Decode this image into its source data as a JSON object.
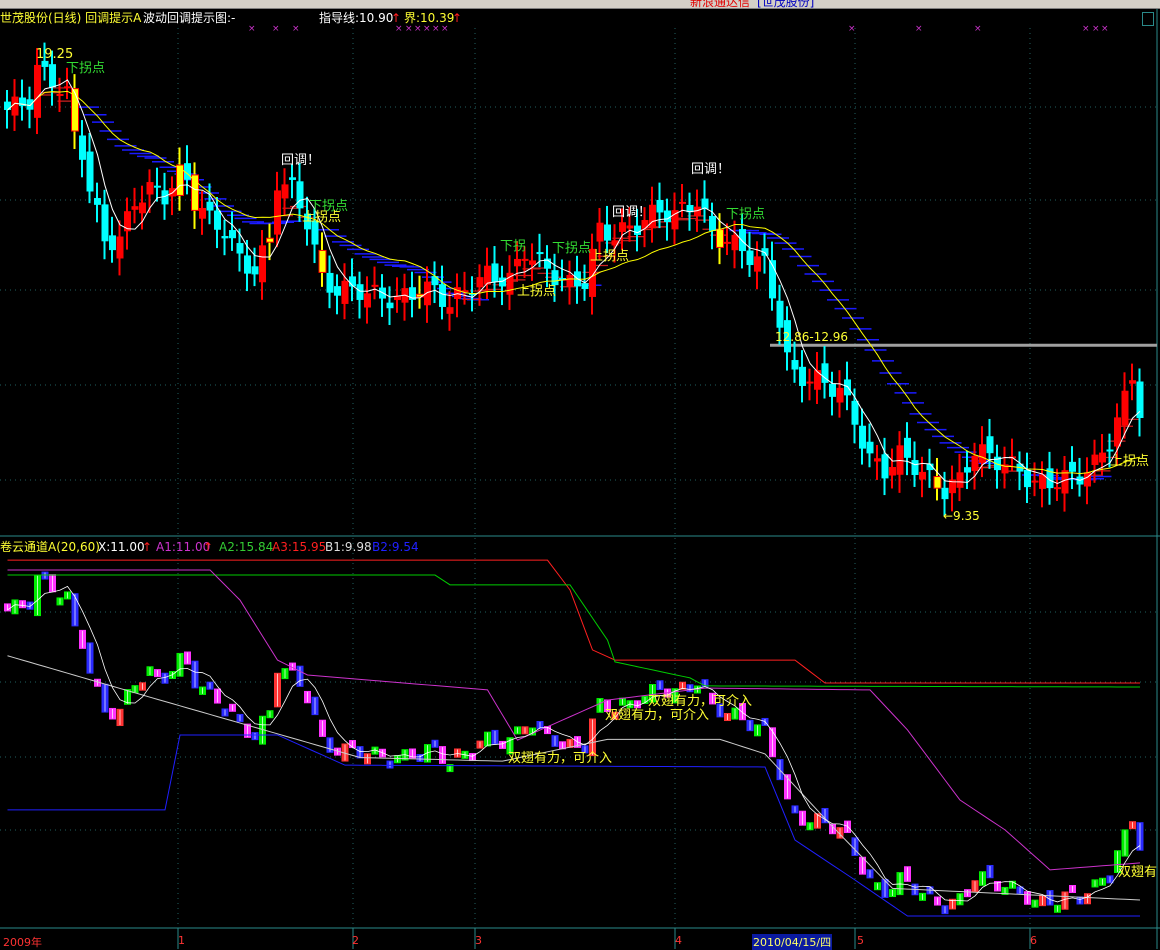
{
  "window": {
    "title_red": "新浪通达信",
    "title_blue": "[世茂股份]"
  },
  "top_panel": {
    "header": {
      "name": "世茂股份(日线) 回调提示A",
      "subtitle": "波动回调提示图:-",
      "guide_label": "指导线:10.90",
      "bound_label": "界:10.39",
      "up_arrow": "↑"
    },
    "marker_glyph": "×",
    "annotations": {
      "high": "19.25",
      "low": "←9.35",
      "range": "12.86-12.96",
      "down_turn": "下拐点",
      "down_turn_partial": "下拐",
      "up_turn": "上拐点",
      "pullback": "回调！"
    }
  },
  "bottom_panel": {
    "header": {
      "name": "卷云通道A(20,60)",
      "x": "X:11.00",
      "a1": "A1:11.00",
      "a2": "A2:15.84",
      "a3": "A3:15.95",
      "b1": "B1:9.98",
      "b2": "B2:9.54",
      "up_arrow": "↑"
    },
    "signal_text": "双翅有力，可介入",
    "signal_text_partial": "双翅有"
  },
  "x_axis": {
    "labels": [
      "2009年",
      "1",
      "2",
      "3",
      "4",
      "5",
      "6"
    ],
    "cursor_date": "2010/04/15/四"
  },
  "colors": {
    "up": "#ff0000",
    "down": "#00ffff",
    "flag": "#ffff00",
    "ma_short": "#ffffff",
    "ma_long": "#ffff00",
    "a1": "#cc33cc",
    "a2": "#00cc00",
    "a3": "#ff2020",
    "b1": "#cccccc",
    "b2": "#2020ff",
    "grid": "#1f5f5f"
  },
  "chart_data": {
    "type": "candlestick",
    "price_range_top": [
      9.2,
      19.4
    ],
    "close_keypoints": [
      [
        0,
        17.96
      ],
      [
        3,
        18.17
      ],
      [
        4,
        18.82
      ],
      [
        6,
        18.6
      ],
      [
        8,
        18.28
      ],
      [
        9,
        17.42
      ],
      [
        10,
        17.1
      ],
      [
        11,
        16.24
      ],
      [
        13,
        15.16
      ],
      [
        15,
        15.16
      ],
      [
        17,
        16.02
      ],
      [
        19,
        16.24
      ],
      [
        21,
        16.13
      ],
      [
        23,
        16.56
      ],
      [
        24,
        16.45
      ],
      [
        25,
        16.02
      ],
      [
        27,
        15.59
      ],
      [
        29,
        15.38
      ],
      [
        31,
        14.73
      ],
      [
        33,
        14.52
      ],
      [
        35,
        15.16
      ],
      [
        36,
        16.45
      ],
      [
        38,
        16.24
      ],
      [
        40,
        15.59
      ],
      [
        42,
        14.3
      ],
      [
        44,
        14.09
      ],
      [
        47,
        14.09
      ],
      [
        49,
        13.98
      ],
      [
        52,
        13.87
      ],
      [
        55,
        14.09
      ],
      [
        57,
        14.09
      ],
      [
        59,
        13.77
      ],
      [
        61,
        14.09
      ],
      [
        64,
        14.41
      ],
      [
        67,
        14.3
      ],
      [
        69,
        14.95
      ],
      [
        72,
        14.52
      ],
      [
        75,
        14.2
      ],
      [
        77,
        14.3
      ],
      [
        79,
        15.38
      ],
      [
        81,
        15.27
      ],
      [
        84,
        15.49
      ],
      [
        87,
        15.81
      ],
      [
        89,
        15.7
      ],
      [
        92,
        16.02
      ],
      [
        94,
        15.27
      ],
      [
        96,
        15.16
      ],
      [
        99,
        14.84
      ],
      [
        101,
        14.63
      ],
      [
        103,
        13.44
      ],
      [
        104,
        12.58
      ],
      [
        105,
        12.26
      ],
      [
        108,
        12.15
      ],
      [
        111,
        11.94
      ],
      [
        113,
        11.29
      ],
      [
        115,
        10.43
      ],
      [
        117,
        10.22
      ],
      [
        119,
        10.54
      ],
      [
        121,
        10.33
      ],
      [
        123,
        10.0
      ],
      [
        125,
        9.79
      ],
      [
        127,
        10.0
      ],
      [
        129,
        10.65
      ],
      [
        132,
        10.43
      ],
      [
        135,
        10.22
      ],
      [
        137,
        9.9
      ],
      [
        140,
        10.0
      ],
      [
        143,
        10.11
      ],
      [
        145,
        10.33
      ],
      [
        147,
        10.86
      ],
      [
        149,
        11.72
      ],
      [
        150,
        12.26
      ],
      [
        151,
        11.51
      ]
    ],
    "flag_bars": [
      9,
      23,
      25,
      35,
      42,
      55,
      95,
      124
    ],
    "high": 19.25,
    "low": 9.35,
    "support_line": 12.9,
    "channel_lines": {
      "A3": [
        [
          0,
          19.33
        ],
        [
          72,
          19.33
        ],
        [
          75,
          18.51
        ],
        [
          78,
          16.86
        ],
        [
          81,
          16.58
        ],
        [
          105,
          16.58
        ],
        [
          109,
          15.95
        ],
        [
          151,
          15.95
        ]
      ],
      "A2": [
        [
          0,
          18.92
        ],
        [
          57,
          18.92
        ],
        [
          59,
          18.65
        ],
        [
          75,
          18.65
        ],
        [
          80,
          17.13
        ],
        [
          81,
          16.53
        ],
        [
          91,
          16.09
        ],
        [
          93,
          15.87
        ],
        [
          151,
          15.84
        ]
      ],
      "A1": [
        [
          0,
          19.06
        ],
        [
          27,
          19.06
        ],
        [
          31,
          18.23
        ],
        [
          36,
          16.58
        ],
        [
          40,
          16.17
        ],
        [
          64,
          15.76
        ],
        [
          68,
          14.38
        ],
        [
          80,
          15.48
        ],
        [
          93,
          15.81
        ],
        [
          115,
          15.76
        ],
        [
          120,
          14.66
        ],
        [
          127,
          12.73
        ],
        [
          133,
          11.91
        ],
        [
          139,
          10.81
        ],
        [
          151,
          11.0
        ]
      ],
      "B2": [
        [
          0,
          12.46
        ],
        [
          21,
          12.46
        ],
        [
          23,
          14.52
        ],
        [
          36,
          14.52
        ],
        [
          45,
          13.69
        ],
        [
          101,
          13.64
        ],
        [
          105,
          11.63
        ],
        [
          113,
          10.53
        ],
        [
          120,
          9.54
        ],
        [
          151,
          9.54
        ]
      ],
      "B1": [
        [
          0,
          16.7
        ],
        [
          20,
          15.5
        ],
        [
          47,
          13.9
        ],
        [
          66,
          13.8
        ],
        [
          80,
          14.4
        ],
        [
          95,
          14.4
        ],
        [
          101,
          14.0
        ],
        [
          110,
          12.0
        ],
        [
          118,
          10.3
        ],
        [
          151,
          9.98
        ]
      ]
    }
  }
}
